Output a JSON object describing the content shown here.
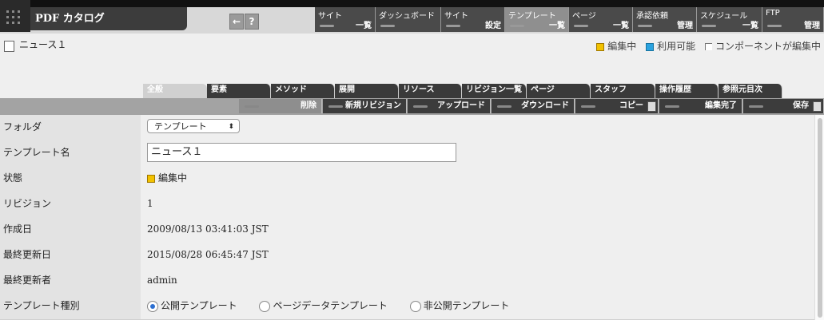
{
  "app": {
    "title": "PDF カタログ",
    "icon_back": "←",
    "icon_help": "?"
  },
  "nav": [
    {
      "top": "サイト",
      "bottom": "一覧"
    },
    {
      "top": "ダッシュボード",
      "bottom": ""
    },
    {
      "top": "サイト",
      "bottom": "設定"
    },
    {
      "top": "テンプレート",
      "bottom": "一覧"
    },
    {
      "top": "ページ",
      "bottom": "一覧"
    },
    {
      "top": "承認依頼",
      "bottom": "管理"
    },
    {
      "top": "スケジュール",
      "bottom": "一覧"
    },
    {
      "top": "FTP",
      "bottom": "管理"
    }
  ],
  "page": {
    "title": "ニュース１"
  },
  "legend": [
    {
      "label": "編集中",
      "color": "#f2c200"
    },
    {
      "label": "利用可能",
      "color": "#2ba3e0"
    },
    {
      "label": "コンポーネントが編集中",
      "color": "#ffffff"
    }
  ],
  "tabs": [
    "全般",
    "要素",
    "メソッド",
    "展開",
    "リソース",
    "リビジョン一覧",
    "ページ",
    "スタッフ",
    "操作履歴",
    "参照元目次"
  ],
  "actions": [
    "削除",
    "新規リビジョン",
    "アップロード",
    "ダウンロード",
    "コピー",
    "編集完了",
    "保存"
  ],
  "form": {
    "folder_label": "フォルダ",
    "folder_value": "テンプレート",
    "name_label": "テンプレート名",
    "name_value": "ニュース１",
    "state_label": "状態",
    "state_value": "編集中",
    "revision_label": "リビジョン",
    "revision_value": "1",
    "created_label": "作成日",
    "created_value": "2009/08/13 03:41:03 JST",
    "updated_label": "最終更新日",
    "updated_value": "2015/08/28 06:45:47 JST",
    "updater_label": "最終更新者",
    "updater_value": "admin",
    "type_label": "テンプレート種別",
    "type_options": [
      "公開テンプレート",
      "ページデータテンプレート",
      "非公開テンプレート"
    ]
  }
}
